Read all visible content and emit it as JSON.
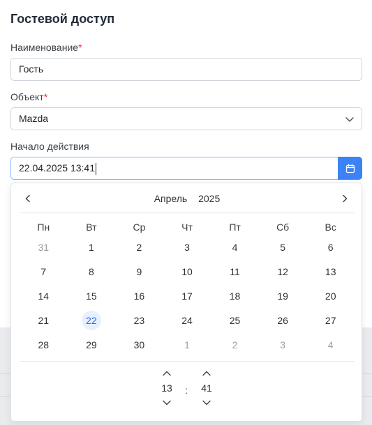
{
  "modal": {
    "title": "Гостевой доступ"
  },
  "form": {
    "name_label": "Наименование",
    "name_value": "Гость",
    "object_label": "Объект",
    "object_value": "Mazda",
    "start_label": "Начало действия",
    "start_value": "22.04.2025 13:41",
    "required_mark": "*"
  },
  "calendar": {
    "month": "Апрель",
    "year": "2025",
    "weekdays": [
      "Пн",
      "Вт",
      "Ср",
      "Чт",
      "Пт",
      "Сб",
      "Вс"
    ],
    "weeks": [
      [
        {
          "d": "31",
          "m": true
        },
        {
          "d": "1"
        },
        {
          "d": "2"
        },
        {
          "d": "3"
        },
        {
          "d": "4"
        },
        {
          "d": "5"
        },
        {
          "d": "6"
        }
      ],
      [
        {
          "d": "7"
        },
        {
          "d": "8"
        },
        {
          "d": "9"
        },
        {
          "d": "10"
        },
        {
          "d": "11"
        },
        {
          "d": "12"
        },
        {
          "d": "13"
        }
      ],
      [
        {
          "d": "14"
        },
        {
          "d": "15"
        },
        {
          "d": "16"
        },
        {
          "d": "17"
        },
        {
          "d": "18"
        },
        {
          "d": "19"
        },
        {
          "d": "20"
        }
      ],
      [
        {
          "d": "21"
        },
        {
          "d": "22",
          "s": true
        },
        {
          "d": "23"
        },
        {
          "d": "24"
        },
        {
          "d": "25"
        },
        {
          "d": "26"
        },
        {
          "d": "27"
        }
      ],
      [
        {
          "d": "28"
        },
        {
          "d": "29"
        },
        {
          "d": "30"
        },
        {
          "d": "1",
          "m": true
        },
        {
          "d": "2",
          "m": true
        },
        {
          "d": "3",
          "m": true
        },
        {
          "d": "4",
          "m": true
        }
      ]
    ],
    "hours": "13",
    "minutes": "41",
    "separator": ":"
  },
  "icons": {
    "prev": "chevron-left-icon",
    "next": "chevron-right-icon",
    "calendar": "calendar-icon",
    "select": "chevron-down-icon"
  },
  "colors": {
    "accent": "#3b82f6",
    "required": "#dc3545",
    "selected_bg": "#e8f0fe",
    "selected_text": "#2b6de5"
  }
}
